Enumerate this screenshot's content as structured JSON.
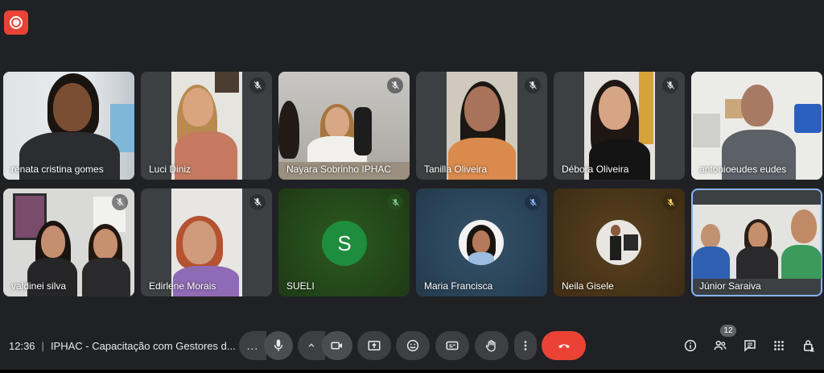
{
  "recording": {
    "icon": "record-icon",
    "color": "#ea4335"
  },
  "participants": [
    {
      "name": "renata cristina gomes",
      "muted": false
    },
    {
      "name": "Luci Diniz",
      "muted": true
    },
    {
      "name": "Nayara Sobrinho IPHAC",
      "muted": true
    },
    {
      "name": "Tanilla Oliveira",
      "muted": true
    },
    {
      "name": "Débora Oliveira",
      "muted": true
    },
    {
      "name": "antonioeudes eudes",
      "muted": false
    },
    {
      "name": "valdinei silva",
      "muted": true
    },
    {
      "name": "Edirlene Morais",
      "muted": true
    },
    {
      "name": "SUELI",
      "muted": true,
      "avatar_letter": "S"
    },
    {
      "name": "Maria Francisca",
      "muted": true
    },
    {
      "name": "Neila Gisele",
      "muted": true
    },
    {
      "name": "Júnior Saraiva",
      "muted": false,
      "active": true
    }
  ],
  "meeting": {
    "time": "12:36",
    "separator": "|",
    "title": "IPHAC - Capacitação com Gestores d..."
  },
  "controls": {
    "more_options": "...",
    "participants_count": "12"
  },
  "colors": {
    "background": "#202124",
    "tile": "#3c4043",
    "end_call": "#ea4335",
    "active_outline": "#8ab4f8"
  }
}
